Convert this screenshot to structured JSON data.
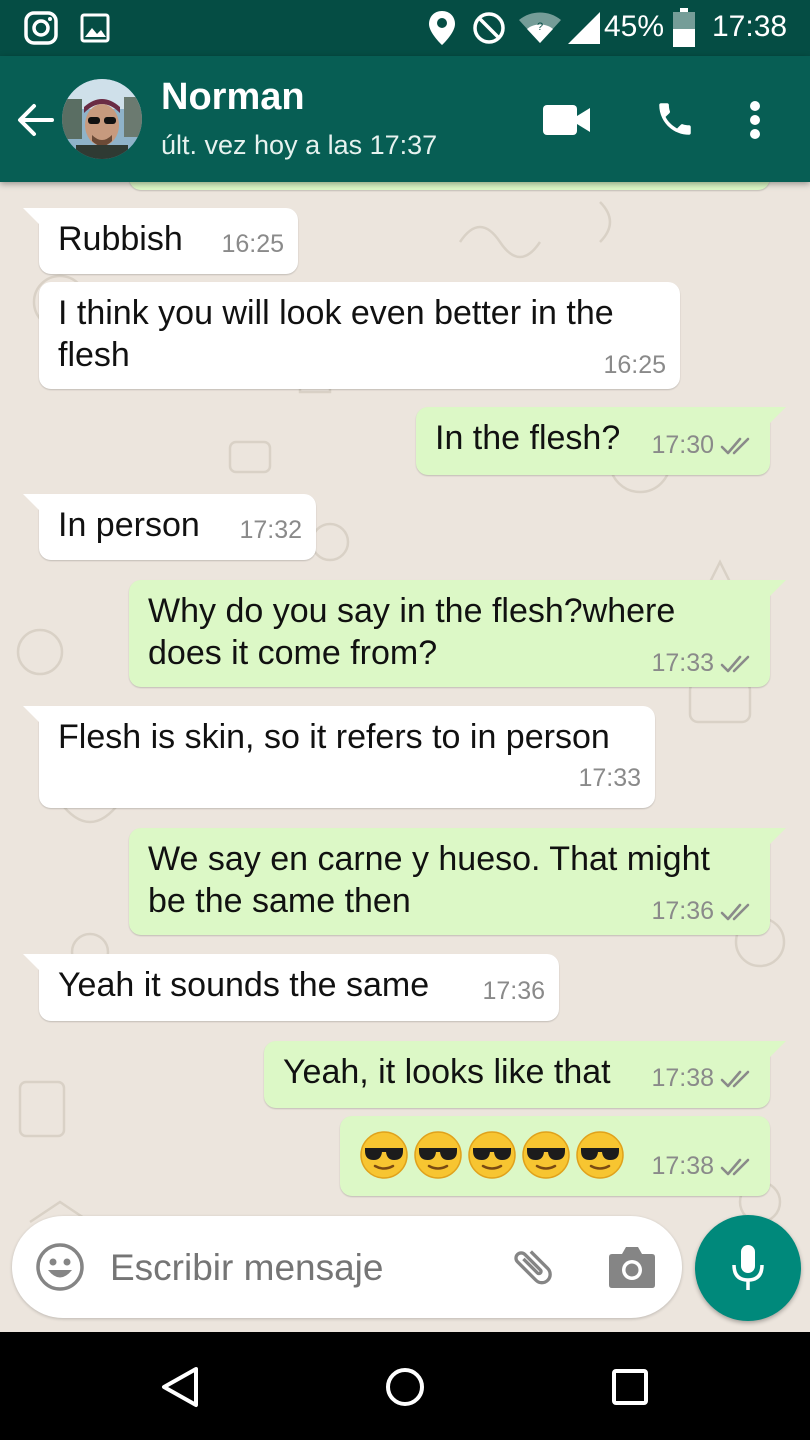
{
  "status_bar": {
    "battery": "45%",
    "time": "17:38",
    "icons": [
      "instagram-icon",
      "gallery-icon",
      "location-icon",
      "do-not-disturb-icon",
      "wifi-icon",
      "signal-icon",
      "battery-icon"
    ]
  },
  "header": {
    "contact_name": "Norman",
    "last_seen": "últ. vez hoy a las 17:37",
    "icons": [
      "back-arrow-icon",
      "avatar",
      "video-call-icon",
      "phone-icon",
      "more-vert-icon"
    ]
  },
  "messages": [
    {
      "dir": "in",
      "lines": [
        "Rubbish"
      ],
      "time": "16:25"
    },
    {
      "dir": "in",
      "lines": [
        "I think you will look even better in the",
        "flesh"
      ],
      "time": "16:25"
    },
    {
      "dir": "out",
      "lines": [
        "In the flesh?"
      ],
      "time": "17:30",
      "status": "read"
    },
    {
      "dir": "in",
      "lines": [
        "In person"
      ],
      "time": "17:32"
    },
    {
      "dir": "out",
      "lines": [
        "Why do you say in the flesh?where",
        "does it come from?"
      ],
      "time": "17:33",
      "status": "read"
    },
    {
      "dir": "in",
      "lines": [
        "Flesh is skin, so it refers to in person"
      ],
      "time": "17:33"
    },
    {
      "dir": "out",
      "lines": [
        "We say en carne y hueso. That might",
        "be the same then"
      ],
      "time": "17:36",
      "status": "read"
    },
    {
      "dir": "in",
      "lines": [
        "Yeah it sounds the same"
      ],
      "time": "17:36"
    },
    {
      "dir": "out",
      "lines": [
        "Yeah, it looks like that"
      ],
      "time": "17:38",
      "status": "read"
    },
    {
      "dir": "out",
      "emoji": "sunglasses-face",
      "emoji_count": 5,
      "time": "17:38",
      "status": "read"
    }
  ],
  "composer": {
    "placeholder": "Escribir mensaje",
    "icons": [
      "emoji-icon",
      "attach-icon",
      "camera-icon",
      "mic-icon"
    ]
  },
  "nav": {
    "icons": [
      "back-triangle-icon",
      "home-circle-icon",
      "recents-square-icon"
    ]
  },
  "colors": {
    "status_bar": "#054d44",
    "app_bar": "#075e54",
    "outgoing_bubble": "#dcf8c6",
    "incoming_bubble": "#ffffff",
    "chat_background": "#ece5dd",
    "mic_button": "#00897b",
    "read_ticks": "#8a8a8a"
  }
}
